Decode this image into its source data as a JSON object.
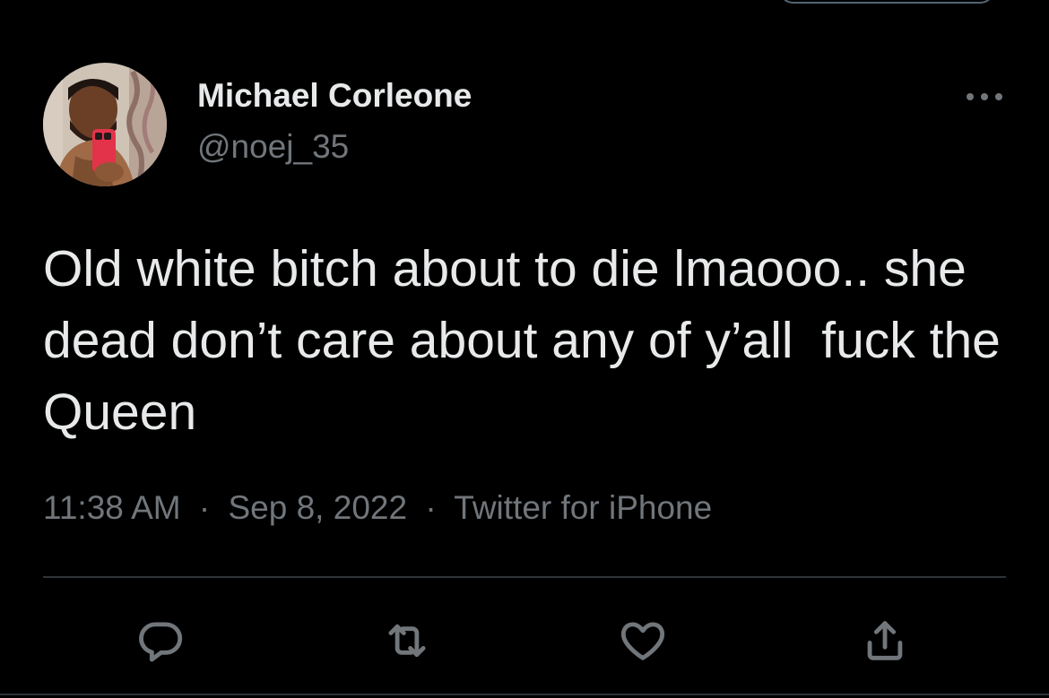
{
  "tweet": {
    "author": {
      "display_name": "Michael Corleone",
      "handle": "@noej_35",
      "avatar": "avatar-photo"
    },
    "text": "Old white bitch about to die lmaooo.. she dead don’t care about any of y’all  fuck the Queen",
    "meta": {
      "time": "11:38 AM",
      "separator": "·",
      "date": "Sep 8, 2022",
      "source": "Twitter for iPhone"
    },
    "actions": [
      {
        "name": "reply",
        "icon": "reply-icon"
      },
      {
        "name": "retweet",
        "icon": "retweet-icon"
      },
      {
        "name": "like",
        "icon": "heart-icon"
      },
      {
        "name": "share",
        "icon": "share-icon"
      }
    ]
  },
  "colors": {
    "background": "#000000",
    "primary_text": "#e7e9ea",
    "secondary_text": "#71767b",
    "divider": "#2f3336"
  }
}
